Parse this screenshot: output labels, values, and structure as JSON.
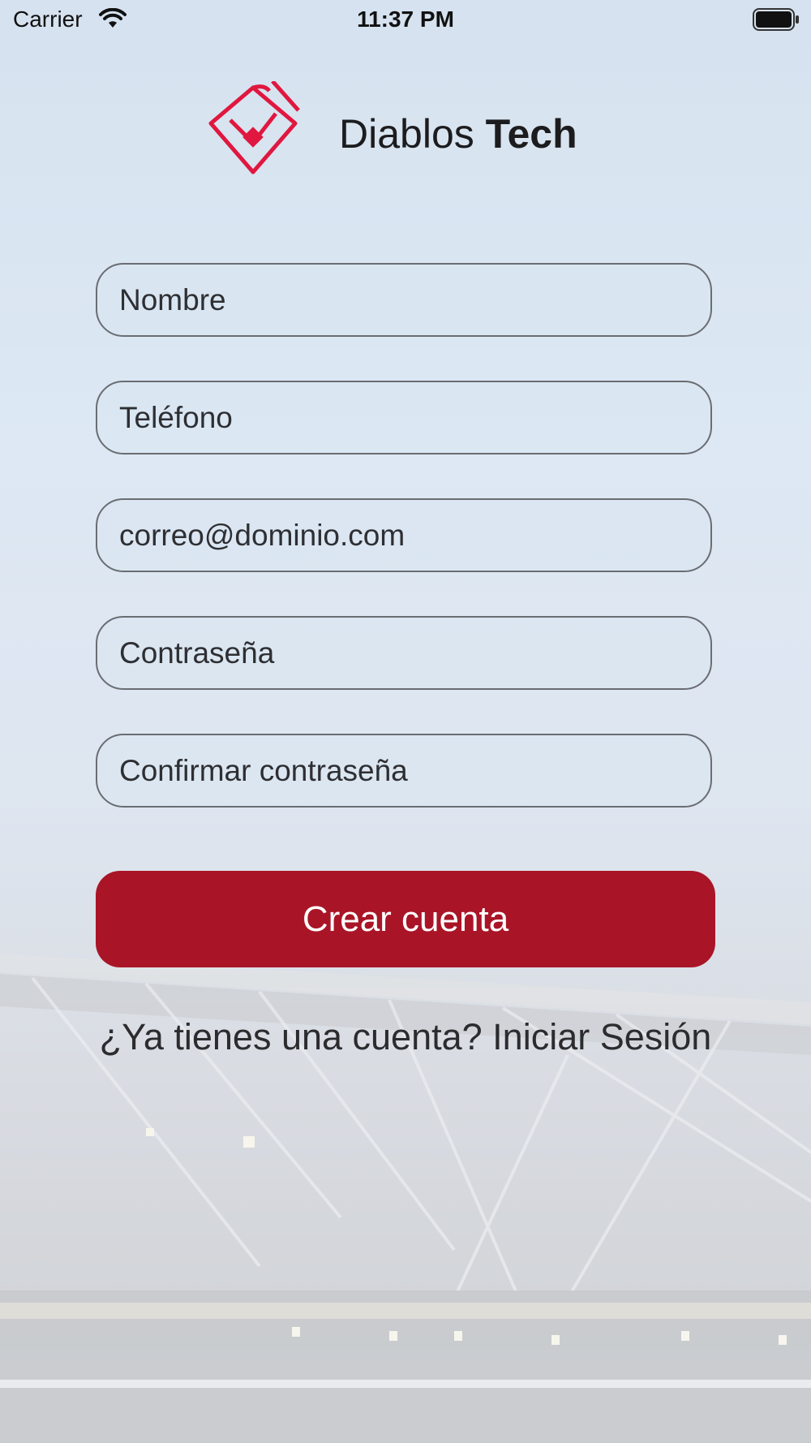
{
  "status_bar": {
    "carrier": "Carrier",
    "time": "11:37 PM",
    "icons": [
      "wifi-icon",
      "battery-icon"
    ]
  },
  "brand": {
    "logo_icon": "baseball-diamond-logo-icon",
    "name_regular": "Diablos",
    "name_bold": "Tech",
    "accent_color": "#e0173f"
  },
  "form": {
    "fields": [
      {
        "name": "name-field",
        "placeholder": "Nombre"
      },
      {
        "name": "phone-field",
        "placeholder": "Teléfono"
      },
      {
        "name": "email-field",
        "placeholder": "correo@dominio.com"
      },
      {
        "name": "password-field",
        "placeholder": "Contraseña"
      },
      {
        "name": "confirm-password-field",
        "placeholder": "Confirmar contraseña"
      }
    ],
    "submit_label": "Crear cuenta",
    "submit_color": "#a91527",
    "signin_prompt": "¿Ya tienes una cuenta? Iniciar Sesión"
  },
  "background": {
    "image": "stadium-background"
  }
}
